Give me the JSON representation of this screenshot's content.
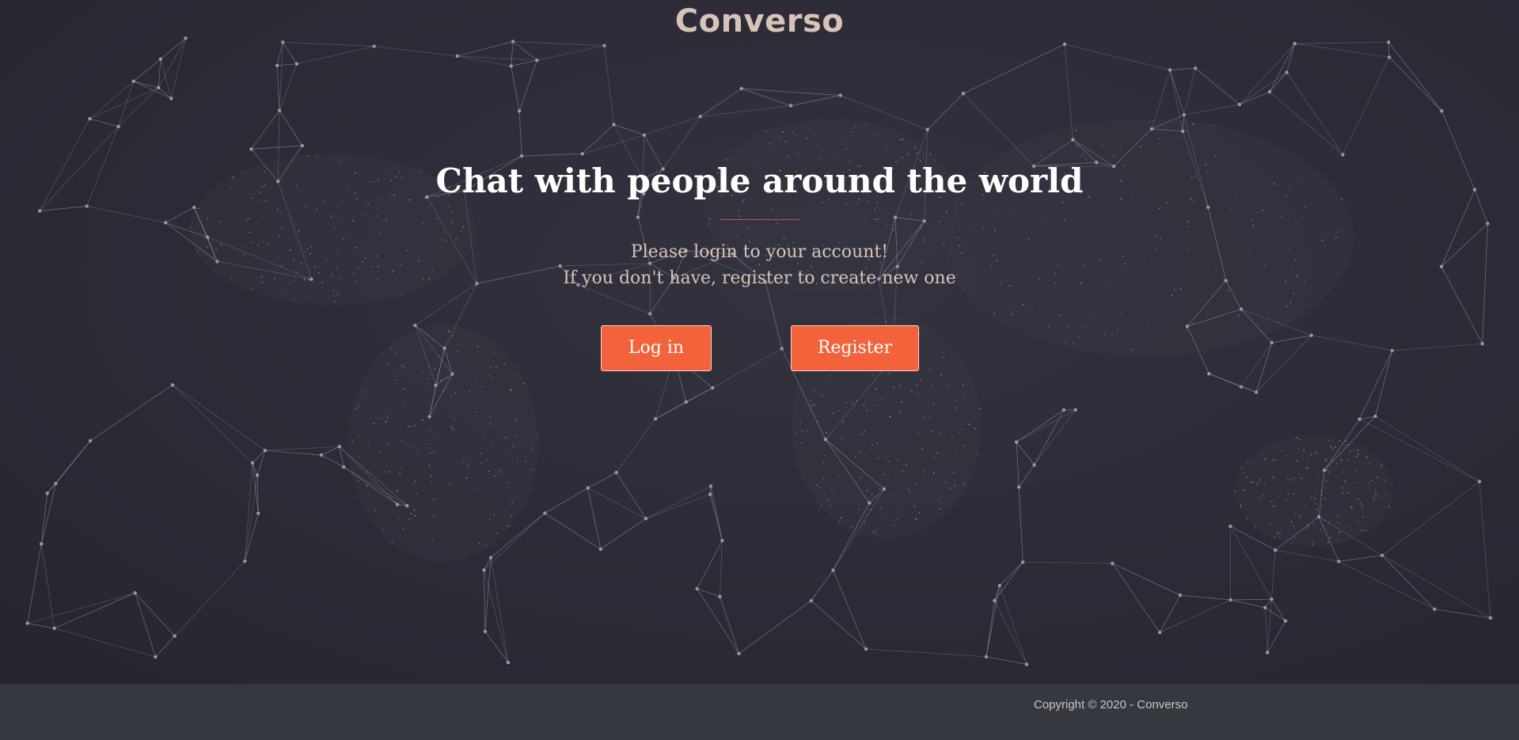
{
  "header": {
    "brand": "Converso"
  },
  "hero": {
    "headline": "Chat with people around the world",
    "subtitle_line1": "Please login to your account!",
    "subtitle_line2": "If you don't have, register to create new one"
  },
  "actions": {
    "login_label": "Log in",
    "register_label": "Register"
  },
  "footer": {
    "copyright": "Copyright © 2020 - Converso"
  },
  "colors": {
    "background": "#2b2a36",
    "accent": "#f2633b",
    "footer": "#363840",
    "brand_text": "#d8c3b8"
  }
}
